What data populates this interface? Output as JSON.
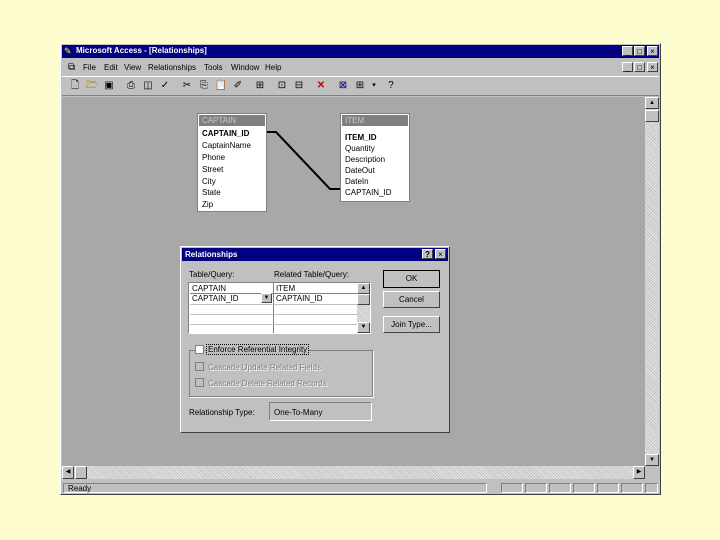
{
  "window": {
    "title": "Microsoft Access - [Relationships]",
    "minimize": "_",
    "maximize": "□",
    "close": "×",
    "inner_minimize": "_",
    "inner_maximize": "□",
    "inner_close": "×"
  },
  "menu": [
    "File",
    "Edit",
    "View",
    "Relationships",
    "Tools",
    "Window",
    "Help"
  ],
  "toolbar": {
    "icons": [
      "doc-icon",
      "folder-open-icon",
      "save-icon",
      "print-icon",
      "print-preview-icon",
      "spelling-icon",
      "cut-icon",
      "copy-icon",
      "paste-icon",
      "format-painter-icon",
      "show-table-icon",
      "show-direct-icon",
      "show-all-icon",
      "delete-icon",
      "database-window-icon",
      "new-object-icon",
      "help-icon"
    ]
  },
  "tables": [
    {
      "title": "CAPTAIN",
      "fields": [
        "CAPTAIN_ID",
        "CaptainName",
        "Phone",
        "Street",
        "City",
        "State",
        "Zip"
      ]
    },
    {
      "title": "ITEM",
      "fields": [
        "ITEM_ID",
        "Quantity",
        "Description",
        "DateOut",
        "DateIn",
        "CAPTAIN_ID"
      ]
    }
  ],
  "dialog": {
    "title": "Relationships",
    "help": "?",
    "close": "×",
    "table_query_label": "Table/Query:",
    "related_label": "Related Table/Query:",
    "grid": {
      "left_table": "CAPTAIN",
      "right_table": "ITEM",
      "left_field": "CAPTAIN_ID",
      "right_field": "CAPTAIN_ID"
    },
    "ok": "OK",
    "cancel": "Cancel",
    "join_type": "Join Type...",
    "enforce": "Enforce Referential Integrity",
    "cascade_update": "Cascade Update Related Fields",
    "cascade_delete": "Cascade Delete Related Records",
    "relationship_type_label": "Relationship Type:",
    "relationship_type_value": "One-To-Many"
  },
  "status": {
    "text": "Ready"
  }
}
